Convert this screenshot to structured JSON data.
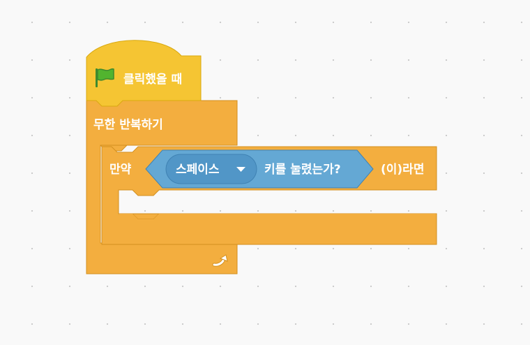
{
  "blocks": {
    "hat": {
      "label": "클릭했을 때",
      "icon": "green-flag-icon",
      "color": "#f5c533",
      "border": "#d9a90f"
    },
    "forever": {
      "label": "무한 반복하기",
      "icon": "loop-arrow-icon",
      "color": "#f3ae3f",
      "border": "#d3901f"
    },
    "if_block": {
      "label_if": "만약",
      "label_then": "(이)라면",
      "color": "#f3ae3f",
      "border": "#d3901f"
    },
    "sensing": {
      "dropdown_value": "스페이스",
      "label": "키를 눌렸는가?",
      "color": "#64a8d4",
      "dropdown_color": "#5196c7",
      "border": "#3f82b3"
    }
  }
}
